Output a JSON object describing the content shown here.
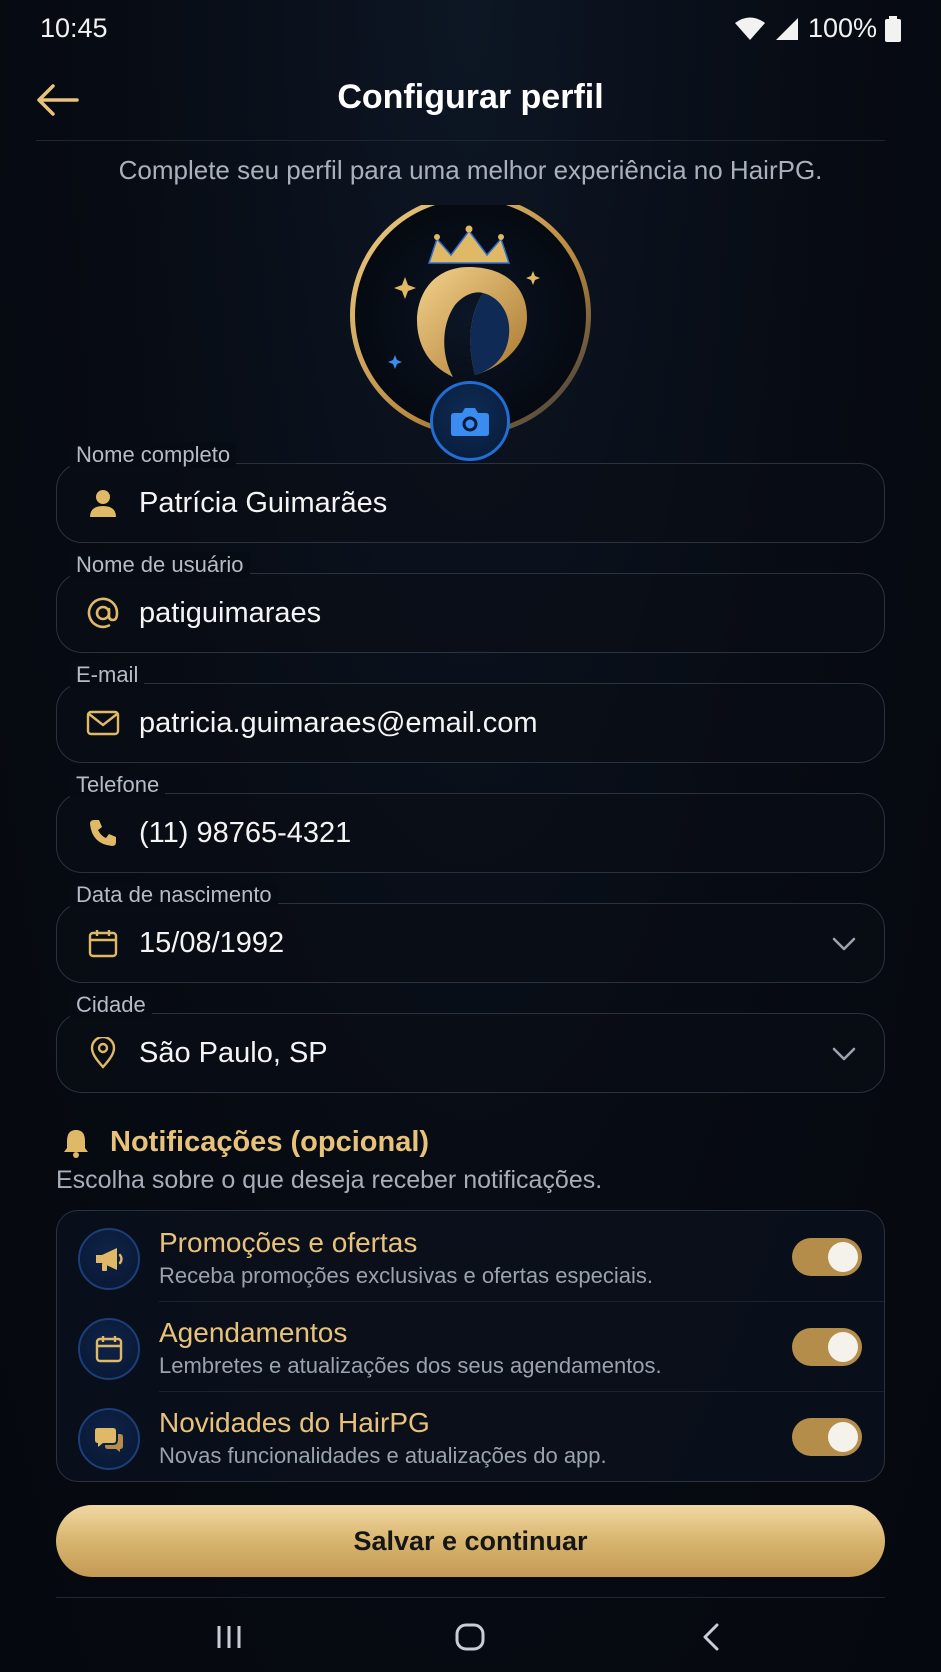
{
  "status_bar": {
    "time": "10:45",
    "battery": "100%"
  },
  "header": {
    "title": "Configurar perfil"
  },
  "subtitle": "Complete seu perfil para uma melhor experiência no HairPG.",
  "fields": {
    "name": {
      "label": "Nome completo",
      "value": "Patrícia Guimarães",
      "icon": "person-icon"
    },
    "username": {
      "label": "Nome de usuário",
      "value": "patiguimaraes",
      "icon": "at-icon"
    },
    "email": {
      "label": "E-mail",
      "value": "patricia.guimaraes@email.com",
      "icon": "mail-icon"
    },
    "phone": {
      "label": "Telefone",
      "value": "(11) 98765-4321",
      "icon": "phone-icon"
    },
    "birthdate": {
      "label": "Data de nascimento",
      "value": "15/08/1992",
      "icon": "calendar-icon"
    },
    "city": {
      "label": "Cidade",
      "value": "São Paulo, SP",
      "icon": "location-pin-icon"
    }
  },
  "notifications": {
    "title": "Notificações (opcional)",
    "subtitle": "Escolha sobre o que deseja receber notificações.",
    "items": [
      {
        "title": "Promoções e ofertas",
        "desc": "Receba promoções exclusivas e ofertas especiais.",
        "enabled": true,
        "icon": "megaphone-icon"
      },
      {
        "title": "Agendamentos",
        "desc": "Lembretes e atualizações dos seus agendamentos.",
        "enabled": true,
        "icon": "calendar-icon"
      },
      {
        "title": "Novidades do HairPG",
        "desc": "Novas funcionalidades e atualizações do app.",
        "enabled": true,
        "icon": "chat-bubbles-icon"
      }
    ]
  },
  "save_button": "Salvar e continuar",
  "colors": {
    "accent_gold": "#e8c27a",
    "accent_blue": "#1f6fd6",
    "background": "#070b13"
  }
}
